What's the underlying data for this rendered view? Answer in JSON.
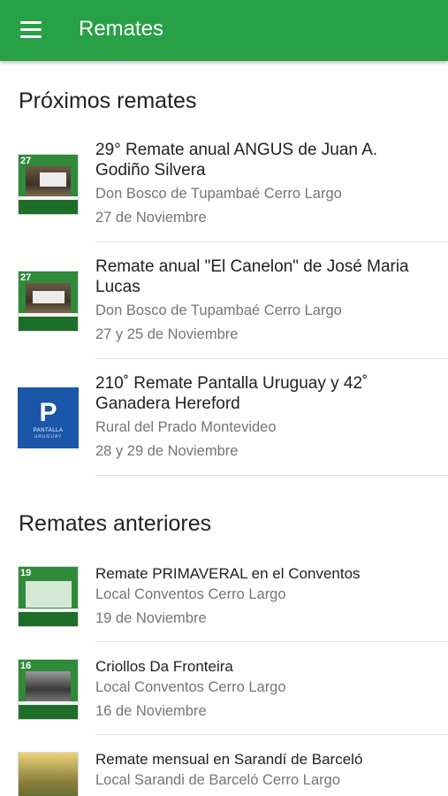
{
  "appbar": {
    "title": "Remates",
    "menu_icon": "hamburger-menu-icon",
    "color": "#27a046"
  },
  "upcoming": {
    "heading": "Próximos remates",
    "items": [
      {
        "badge": "27",
        "title": "29° Remate anual ANGUS de Juan A. Godiño Silvera",
        "location": "Don Bosco de Tupambaé Cerro Largo",
        "date": "27 de Noviembre"
      },
      {
        "badge": "27",
        "title": "Remate anual \"El Canelon\" de José Maria Lucas",
        "location": "Don Bosco de Tupambaé Cerro Largo",
        "date": "27 y 25 de Noviembre"
      },
      {
        "badge": "P",
        "title": "210˚ Remate Pantalla Uruguay y 42˚ Ganadera Hereford",
        "location": "Rural del Prado Montevideo",
        "date": "28 y 29 de Noviembre",
        "logo_text": "PANTALLA",
        "logo_sub": "URUGUAY"
      }
    ]
  },
  "past": {
    "heading": "Remates anteriores",
    "items": [
      {
        "badge": "19",
        "title": "Remate PRIMAVERAL en el Conventos",
        "location": "Local Conventos Cerro Largo",
        "date": "19 de Noviembre"
      },
      {
        "badge": "16",
        "title": "Criollos Da Fronteira",
        "location": "Local Conventos Cerro Largo",
        "date": "16 de Noviembre"
      },
      {
        "badge": "",
        "title": "Remate mensual en Sarandí de Barceló",
        "location": "Local Sarandi de Barceló Cerro Largo",
        "date": ""
      }
    ]
  }
}
